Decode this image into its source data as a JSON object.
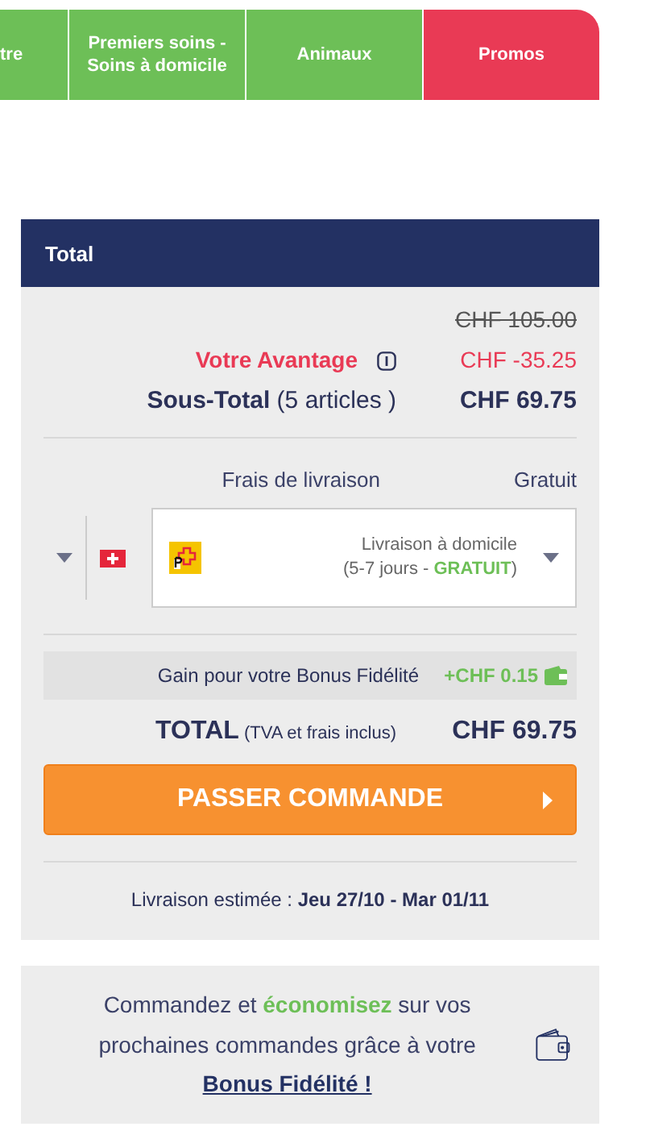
{
  "tabs": [
    {
      "label": "tre",
      "color": "#6dbf57"
    },
    {
      "label": "Premiers soins - Soins à domicile",
      "color": "#6dbf57"
    },
    {
      "label": "Animaux",
      "color": "#6dbf57"
    },
    {
      "label": "Promos",
      "color": "#e93a55"
    }
  ],
  "summary": {
    "title": "Total",
    "original_price": "CHF 105.00",
    "advantage_label": "Votre Avantage",
    "advantage_value": "CHF -35.25",
    "subtotal_label": "Sous-Total",
    "subtotal_count": "(5 articles )",
    "subtotal_value": "CHF 69.75",
    "shipping_label": "Frais de livraison",
    "shipping_value": "Gratuit",
    "delivery": {
      "line1": "Livraison à domicile",
      "line2_before": "(5-7 jours - ",
      "line2_free": "GRATUIT",
      "line2_after": ")"
    },
    "bonus_label": "Gain pour votre Bonus Fidélité",
    "bonus_value": "+CHF 0.15",
    "total_label": "TOTAL",
    "total_note": "(TVA et frais inclus)",
    "total_value": "CHF 69.75",
    "order_button": "PASSER COMMANDE",
    "estimate_label": "Livraison estimée :",
    "estimate_dates": "Jeu 27/10 - Mar 01/11"
  },
  "promo": {
    "text_before": "Commandez et ",
    "highlight": "économisez",
    "text_after": " sur vos prochaines commandes grâce à votre",
    "link": "Bonus Fidélité !"
  }
}
